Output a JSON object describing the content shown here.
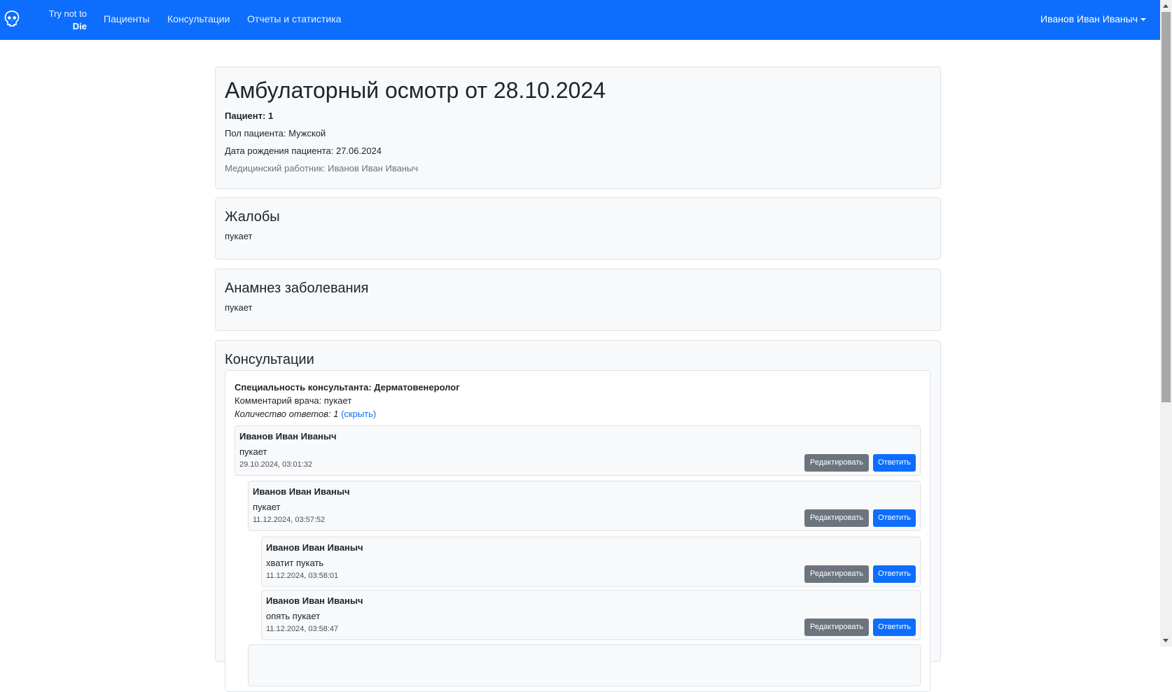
{
  "navbar": {
    "brand_line1": "Try not to",
    "brand_line2": "Die",
    "links": [
      "Пациенты",
      "Консультации",
      "Отчеты и статистика"
    ],
    "user": "Иванов Иван Иваныч"
  },
  "exam": {
    "title": "Амбулаторный осмотр от 28.10.2024",
    "patient": "Пациент: 1",
    "sex": "Пол пациента: Мужской",
    "birth": "Дата рождения пациента: 27.06.2024",
    "doctor": "Медицинский работник: Иванов Иван Иваныч"
  },
  "complaints": {
    "title": "Жалобы",
    "text": "пукает"
  },
  "anamnesis": {
    "title": "Анамнез заболевания",
    "text": "пукает"
  },
  "consultations": {
    "title": "Консультации",
    "specialty": "Специальность консультанта: Дерматовенеролог",
    "comment": "Комментарий врача: пукает",
    "answers_count": "Количество ответов: 1",
    "hide_link": "(скрыть)",
    "edit_label": "Редактировать",
    "reply_label": "Ответить",
    "answers": [
      {
        "author": "Иванов Иван Иваныч",
        "text": "пукает",
        "date": "29.10.2024, 03:01:32"
      },
      {
        "author": "Иванов Иван Иваныч",
        "text": "пукает",
        "date": "11.12.2024, 03:57:52"
      },
      {
        "author": "Иванов Иван Иваныч",
        "text": "хватит пукать",
        "date": "11.12.2024, 03:58:01"
      },
      {
        "author": "Иванов Иван Иваныч",
        "text": "опять пукает",
        "date": "11.12.2024, 03:58:47"
      }
    ]
  }
}
